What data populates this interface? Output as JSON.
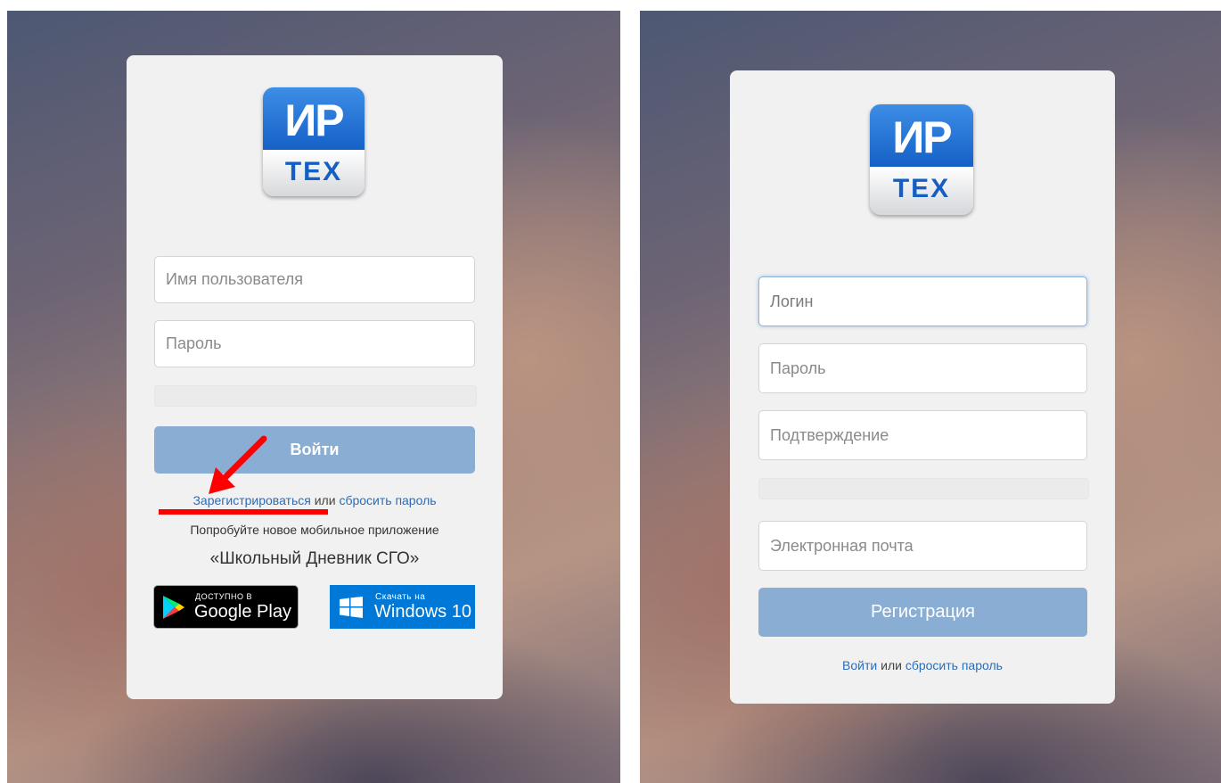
{
  "login": {
    "logo_top": "ИР",
    "logo_bottom": "ТЕХ",
    "username_placeholder": "Имя пользователя",
    "password_placeholder": "Пароль",
    "submit_label": "Войти",
    "register_link": "Зарегистрироваться",
    "or_text": "или",
    "reset_link": "сбросить пароль",
    "promo_text": "Попробуйте новое мобильное приложение",
    "app_name": "«Школьный Дневник СГО»",
    "google_small": "ДОСТУПНО В",
    "google_big": "Google Play",
    "windows_small": "Скачать на",
    "windows_big": "Windows 10"
  },
  "register": {
    "logo_top": "ИР",
    "logo_bottom": "ТЕХ",
    "login_placeholder": "Логин",
    "password_placeholder": "Пароль",
    "confirm_placeholder": "Подтверждение",
    "email_placeholder": "Электронная почта",
    "submit_label": "Регистрация",
    "login_link": "Войти",
    "or_text": "или",
    "reset_link": "сбросить пароль"
  },
  "colors": {
    "button": "#8aadd3",
    "link": "#2a6db8",
    "annotation": "#ff0000",
    "logo_blue": "#1560c7"
  },
  "icons": [
    "google-play-icon",
    "windows-icon",
    "red-arrow-annotation"
  ]
}
